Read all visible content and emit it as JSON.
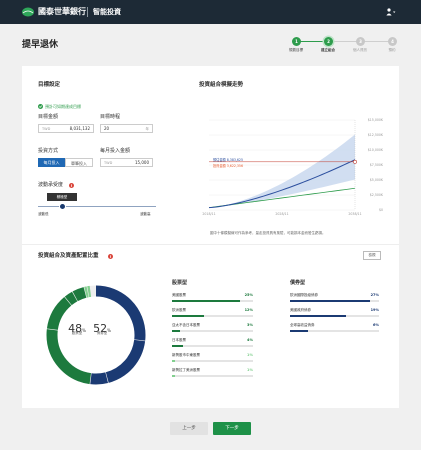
{
  "header": {
    "brand": "國泰世華銀行",
    "product": "智能投資"
  },
  "page": {
    "title": "提早退休"
  },
  "stepper": {
    "steps": [
      {
        "number": "1",
        "label": "規劃目標"
      },
      {
        "number": "2",
        "label": "建立組合"
      },
      {
        "number": "3",
        "label": "個人資訊"
      },
      {
        "number": "4",
        "label": "預約"
      }
    ]
  },
  "goal": {
    "section_title": "目標設定",
    "hint": "預計可如期達成目標",
    "amount_label": "目標金額",
    "amount_currency": "TWD",
    "amount_value": "8,031,132",
    "period_label": "目標時程",
    "period_value": "20",
    "period_unit": "年",
    "method_label": "投資方式",
    "method_options": [
      "每月投入",
      "單筆投入"
    ],
    "monthly_label": "每月投入金額",
    "monthly_currency": "TWD",
    "monthly_value": "15,000",
    "risk_label": "波動承受度",
    "risk_tooltip": "積極型",
    "risk_low": "波動低",
    "risk_high": "波動高"
  },
  "chart_section": {
    "title": "投資組合模擬走勢",
    "note": "圖中十條模擬線可作為參考，量走投資具有風險，可能損本金而發生虧損。"
  },
  "chart_data": {
    "type": "line",
    "x_ticks": [
      "2018/11",
      "2028/11",
      "2038/11"
    ],
    "y_ticks": [
      "$0",
      "$2,500K",
      "$5,000K",
      "$7,500K",
      "$10,000K",
      "$12,500K",
      "$15,000K"
    ],
    "ylim": [
      0,
      15000000
    ],
    "series": [
      {
        "name": "預估金額",
        "label_value": "8,383,625"
      },
      {
        "name": "投資金額",
        "label_value": "3,622,356"
      }
    ],
    "target_label": "目標金額 8,031,132",
    "target_value": 8031132,
    "colors": {
      "projection": "#2c4f9e",
      "band": "#c9d8ee",
      "invested": "#e7572a",
      "line": "#2e9c4c"
    }
  },
  "allocation": {
    "title": "投資組合及資產配置比重",
    "detail_button": "檢視",
    "stock_pct": "48",
    "bond_pct": "52",
    "stock_label": "股票型",
    "bond_label": "債券型",
    "stocks_title": "股票型",
    "bonds_title": "債券型",
    "stocks": [
      {
        "name": "美國股票",
        "pct": "25%",
        "value": 0.25,
        "color": "#1d7a3e"
      },
      {
        "name": "歐洲股票",
        "pct": "12%",
        "value": 0.12,
        "color": "#1d7a3e"
      },
      {
        "name": "亞太不含日本股票",
        "pct": "3%",
        "value": 0.03,
        "color": "#1d7a3e"
      },
      {
        "name": "日本股票",
        "pct": "4%",
        "value": 0.04,
        "color": "#1d7a3e"
      },
      {
        "name": "新興股市中東股票",
        "pct": "1%",
        "value": 0.01,
        "color": "#82d08f"
      },
      {
        "name": "新興拉丁美洲股票",
        "pct": "1%",
        "value": 0.01,
        "color": "#82d08f"
      }
    ],
    "bonds": [
      {
        "name": "歐洲國際投級債券",
        "pct": "27%",
        "value": 0.27,
        "color": "#1b3a73"
      },
      {
        "name": "美國政府債券",
        "pct": "19%",
        "value": 0.19,
        "color": "#1b3a73"
      },
      {
        "name": "全球高收益債券",
        "pct": "6%",
        "value": 0.06,
        "color": "#1b3a73"
      }
    ]
  },
  "footer": {
    "prev": "上一步",
    "next": "下一步"
  }
}
